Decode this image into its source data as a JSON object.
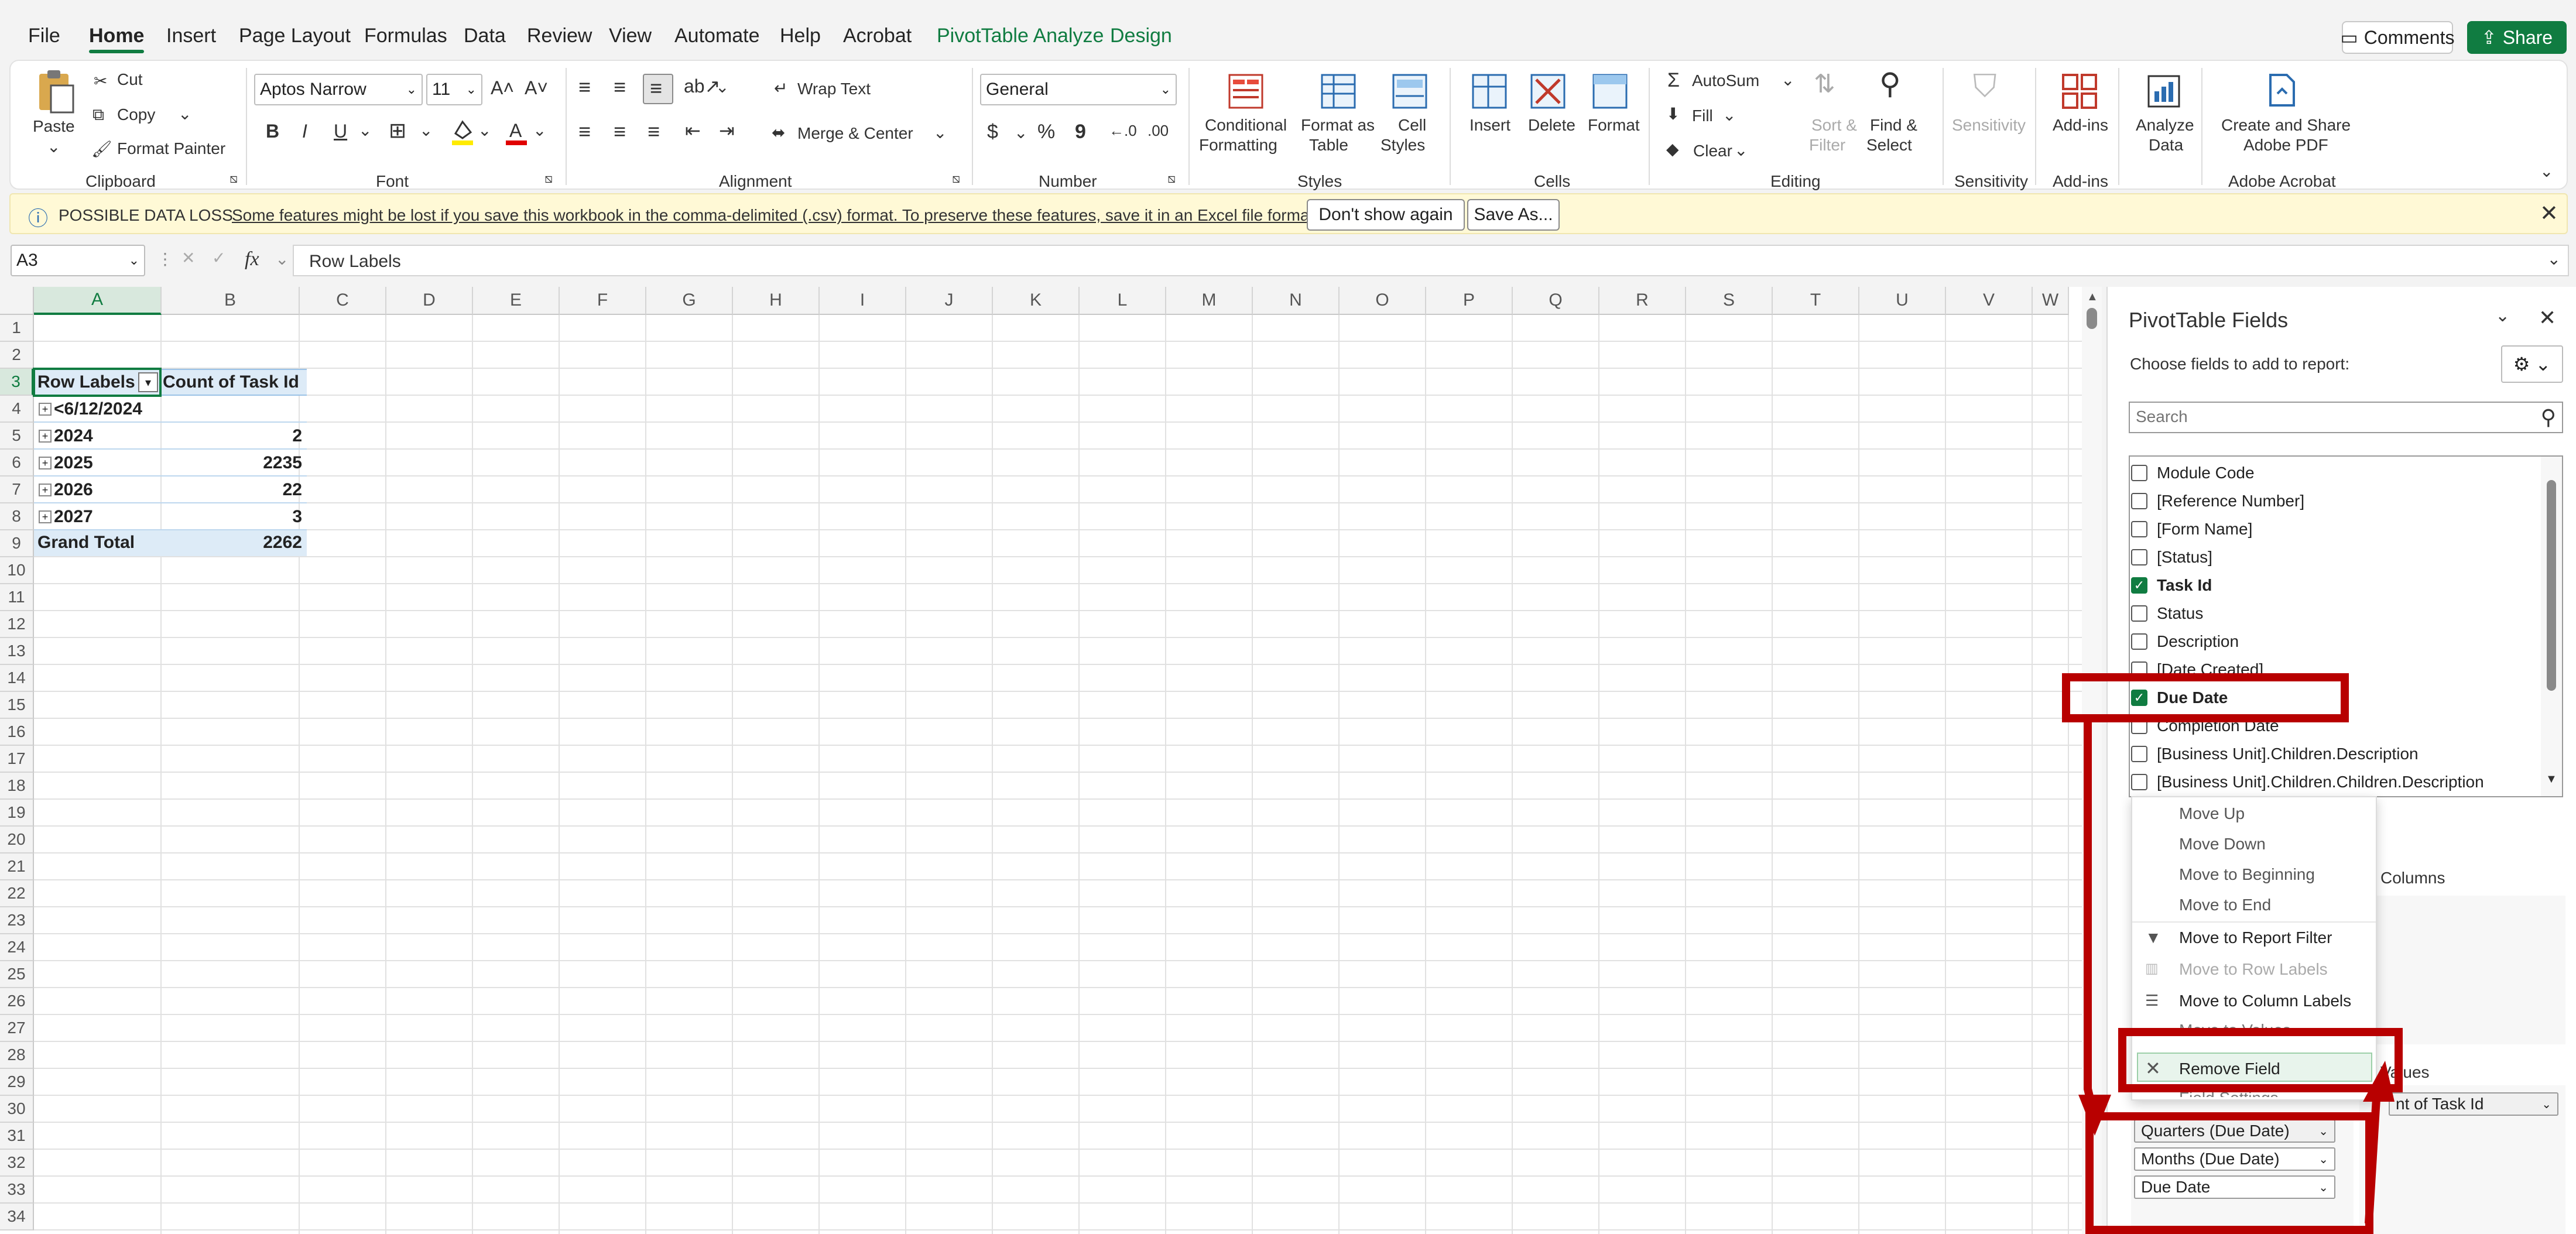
{
  "menu": {
    "tabs": [
      "File",
      "Home",
      "Insert",
      "Page Layout",
      "Formulas",
      "Data",
      "Review",
      "View",
      "Automate",
      "Help",
      "Acrobat",
      "PivotTable Analyze",
      "Design"
    ],
    "comments": "Comments",
    "share": "Share"
  },
  "ribbon": {
    "clipboard": {
      "paste": "Paste",
      "cut": "Cut",
      "copy": "Copy",
      "format_painter": "Format Painter",
      "group": "Clipboard"
    },
    "font": {
      "name": "Aptos Narrow",
      "size": "11",
      "group": "Font",
      "bold": "B",
      "italic": "I",
      "underline": "U"
    },
    "alignment": {
      "wrap": "Wrap Text",
      "merge": "Merge & Center",
      "group": "Alignment"
    },
    "number": {
      "format": "General",
      "currency": "$",
      "percent": "%",
      "comma": "9",
      "group": "Number"
    },
    "styles": {
      "conditional_1": "Conditional",
      "conditional_2": "Formatting",
      "format_table_1": "Format as",
      "format_table_2": "Table",
      "cell_styles_1": "Cell",
      "cell_styles_2": "Styles",
      "group": "Styles"
    },
    "cells": {
      "insert": "Insert",
      "delete": "Delete",
      "format": "Format",
      "group": "Cells"
    },
    "editing": {
      "autosum": "AutoSum",
      "fill": "Fill",
      "clear": "Clear",
      "sort_1": "Sort &",
      "sort_2": "Filter",
      "find_1": "Find &",
      "find_2": "Select",
      "group": "Editing"
    },
    "sensitivity": {
      "label": "Sensitivity",
      "group": "Sensitivity"
    },
    "addins": {
      "label": "Add-ins",
      "group": "Add-ins"
    },
    "analyze": {
      "label_1": "Analyze",
      "label_2": "Data"
    },
    "acrobat": {
      "label_1": "Create and Share",
      "label_2": "Adobe PDF",
      "group": "Adobe Acrobat"
    }
  },
  "warning": {
    "title": "POSSIBLE DATA LOSS",
    "message": "Some features might be lost if you save this workbook in the comma-delimited (.csv) format. To preserve these features, save it in an Excel file format.",
    "dont_show": "Don't show again",
    "save_as": "Save As..."
  },
  "formula_bar": {
    "name_box": "A3",
    "fx": "fx",
    "content": "Row Labels"
  },
  "sheet": {
    "columns": [
      "A",
      "B",
      "C",
      "D",
      "E",
      "F",
      "G",
      "H",
      "I",
      "J",
      "K",
      "L",
      "M",
      "N",
      "O",
      "P",
      "Q",
      "R",
      "S",
      "T",
      "U",
      "V",
      "W"
    ],
    "rows": [
      "1",
      "2",
      "3",
      "4",
      "5",
      "6",
      "7",
      "8",
      "9",
      "10",
      "11",
      "12",
      "13",
      "14",
      "15",
      "16",
      "17",
      "18",
      "19",
      "20",
      "21",
      "22",
      "23",
      "24",
      "25",
      "26",
      "27",
      "28",
      "29",
      "30",
      "31",
      "32",
      "33",
      "34"
    ],
    "pivot": {
      "header_label": "Row Labels",
      "header_value": "Count of Task Id",
      "rows": [
        {
          "label": "<6/12/2024",
          "value": ""
        },
        {
          "label": "2024",
          "value": "2"
        },
        {
          "label": "2025",
          "value": "2235"
        },
        {
          "label": "2026",
          "value": "22"
        },
        {
          "label": "2027",
          "value": "3"
        }
      ],
      "total_label": "Grand Total",
      "total_value": "2262"
    }
  },
  "pane": {
    "title": "PivotTable Fields",
    "subtitle": "Choose fields to add to report:",
    "search_placeholder": "Search",
    "fields": [
      {
        "label": "Module Code",
        "checked": false
      },
      {
        "label": "[Reference Number]",
        "checked": false
      },
      {
        "label": "[Form Name]",
        "checked": false
      },
      {
        "label": "[Status]",
        "checked": false
      },
      {
        "label": "Task Id",
        "checked": true
      },
      {
        "label": "Status",
        "checked": false
      },
      {
        "label": "Description",
        "checked": false
      },
      {
        "label": "[Date Created]",
        "checked": false
      },
      {
        "label": "Due Date",
        "checked": true
      },
      {
        "label": "Completion Date",
        "checked": false
      },
      {
        "label": "[Business Unit].Children.Description",
        "checked": false
      },
      {
        "label": "[Business Unit].Children.Children.Description",
        "checked": false
      }
    ],
    "columns_label": "Columns",
    "values_label": "Values",
    "values_item": "nt of Task Id",
    "row_chips": [
      "Quarters (Due Date)",
      "Months (Due Date)",
      "Due Date"
    ]
  },
  "context_menu": {
    "items": [
      "Move Up",
      "Move Down",
      "Move to Beginning",
      "Move to End",
      "Move to Report Filter",
      "Move to Row Labels",
      "Move to Column Labels",
      "Move to Values",
      "Remove Field",
      "Field Settings..."
    ]
  }
}
